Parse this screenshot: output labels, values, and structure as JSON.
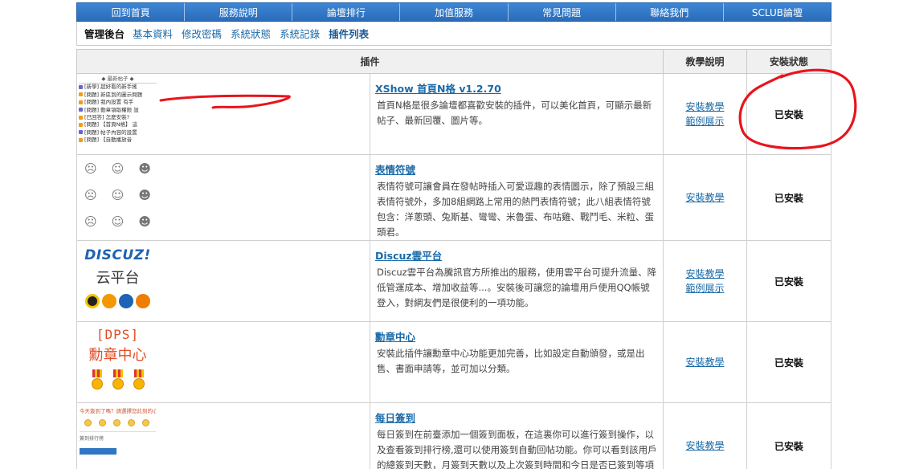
{
  "nav": {
    "items": [
      "回到首頁",
      "服務說明",
      "論壇排行",
      "加值服務",
      "常見問題",
      "聯絡我們",
      "SCLUB論壇"
    ]
  },
  "subnav": {
    "title": "管理後台",
    "links": [
      "基本資料",
      "修改密碼",
      "系統狀態",
      "系統記錄",
      "插件列表"
    ],
    "active_index": 4
  },
  "table": {
    "headers": {
      "plugin": "插件",
      "help": "教學說明",
      "status": "安裝狀態"
    },
    "rows": [
      {
        "name": "XShow 首頁N格 v1.2.70",
        "desc": "首頁N格是很多論壇都喜歡安裝的插件，可以美化首頁，可顯示最新帖子、最新回覆、圖片等。",
        "help": [
          "安裝教學",
          "範例展示"
        ],
        "status": "已安裝",
        "thumb": "posts-grid"
      },
      {
        "name": "表情符號",
        "desc": "表情符號可讓會員在發帖時插入可愛逗趣的表情圖示，除了預設三組表情符號外，多加8組網路上常用的熱門表情符號；此八組表情符號包含：洋蔥頭、兔斯基、彎彎、米魯蛋、布咕雞、戰鬥毛、米粒、蛋頭君。",
        "help": [
          "安裝教學"
        ],
        "status": "已安裝",
        "thumb": "emoji"
      },
      {
        "name": "Discuz雲平台",
        "desc": "Discuz雲平台為騰訊官方所推出的服務，使用雲平台可提升流量、降低管運成本、增加收益等...。安裝後可讓您的論壇用戶使用QQ帳號登入，對網友們是很便利的一項功能。",
        "help": [
          "安裝教學",
          "範例展示"
        ],
        "status": "已安裝",
        "thumb": "discuz"
      },
      {
        "name": "勳章中心",
        "desc": "安裝此插件讓勳章中心功能更加完善，比如設定自動頒發，或是出售、書面申請等，並可加以分類。",
        "help": [
          "安裝教學"
        ],
        "status": "已安裝",
        "thumb": "dps"
      },
      {
        "name": "每日簽到",
        "desc": "每日簽到在前臺添加一個簽到面板，在這裏你可以進行簽到操作，以及查看簽到排行榜,還可以使用簽到自動回帖功能。你可以看到該用戶的總簽到天數，月簽到天數以及上次簽到時間和今日是否已簽到等項目。",
        "help": [
          "安裝教學"
        ],
        "status": "已安裝",
        "thumb": "sign"
      }
    ]
  },
  "thumbs": {
    "posts": {
      "head": "◆ 最新帖子 ◆",
      "rows": [
        "[新學] 超好看的新手搖",
        "[問題] 新區到的圖示問題",
        "[問題] 我內設置 有手",
        "[問題] 動章領取權限 設",
        "[已回答] 怎麼安裝?",
        "[問題] 【首頁N格】 這",
        "[問題] 帖子內容的設置",
        "[問題] 【自動播放音"
      ]
    },
    "discuz": {
      "logo": "DISCUZ!",
      "sub": "云平台"
    },
    "dps": {
      "top": "[DPS]",
      "cn": "勳章中心"
    },
    "sign": {
      "title": "今天簽到了嗎？請選擇您此刻的心情",
      "line": "簽到排行榜"
    }
  },
  "colors": {
    "nav_bg": "#2f76c4",
    "link": "#1a6aa8",
    "annotation": "#e8141c"
  },
  "icons": {
    "emoji_faces": [
      "☹",
      "☺",
      "☻",
      "☹",
      "☺",
      "☻",
      "☹",
      "☺",
      "☻"
    ]
  }
}
